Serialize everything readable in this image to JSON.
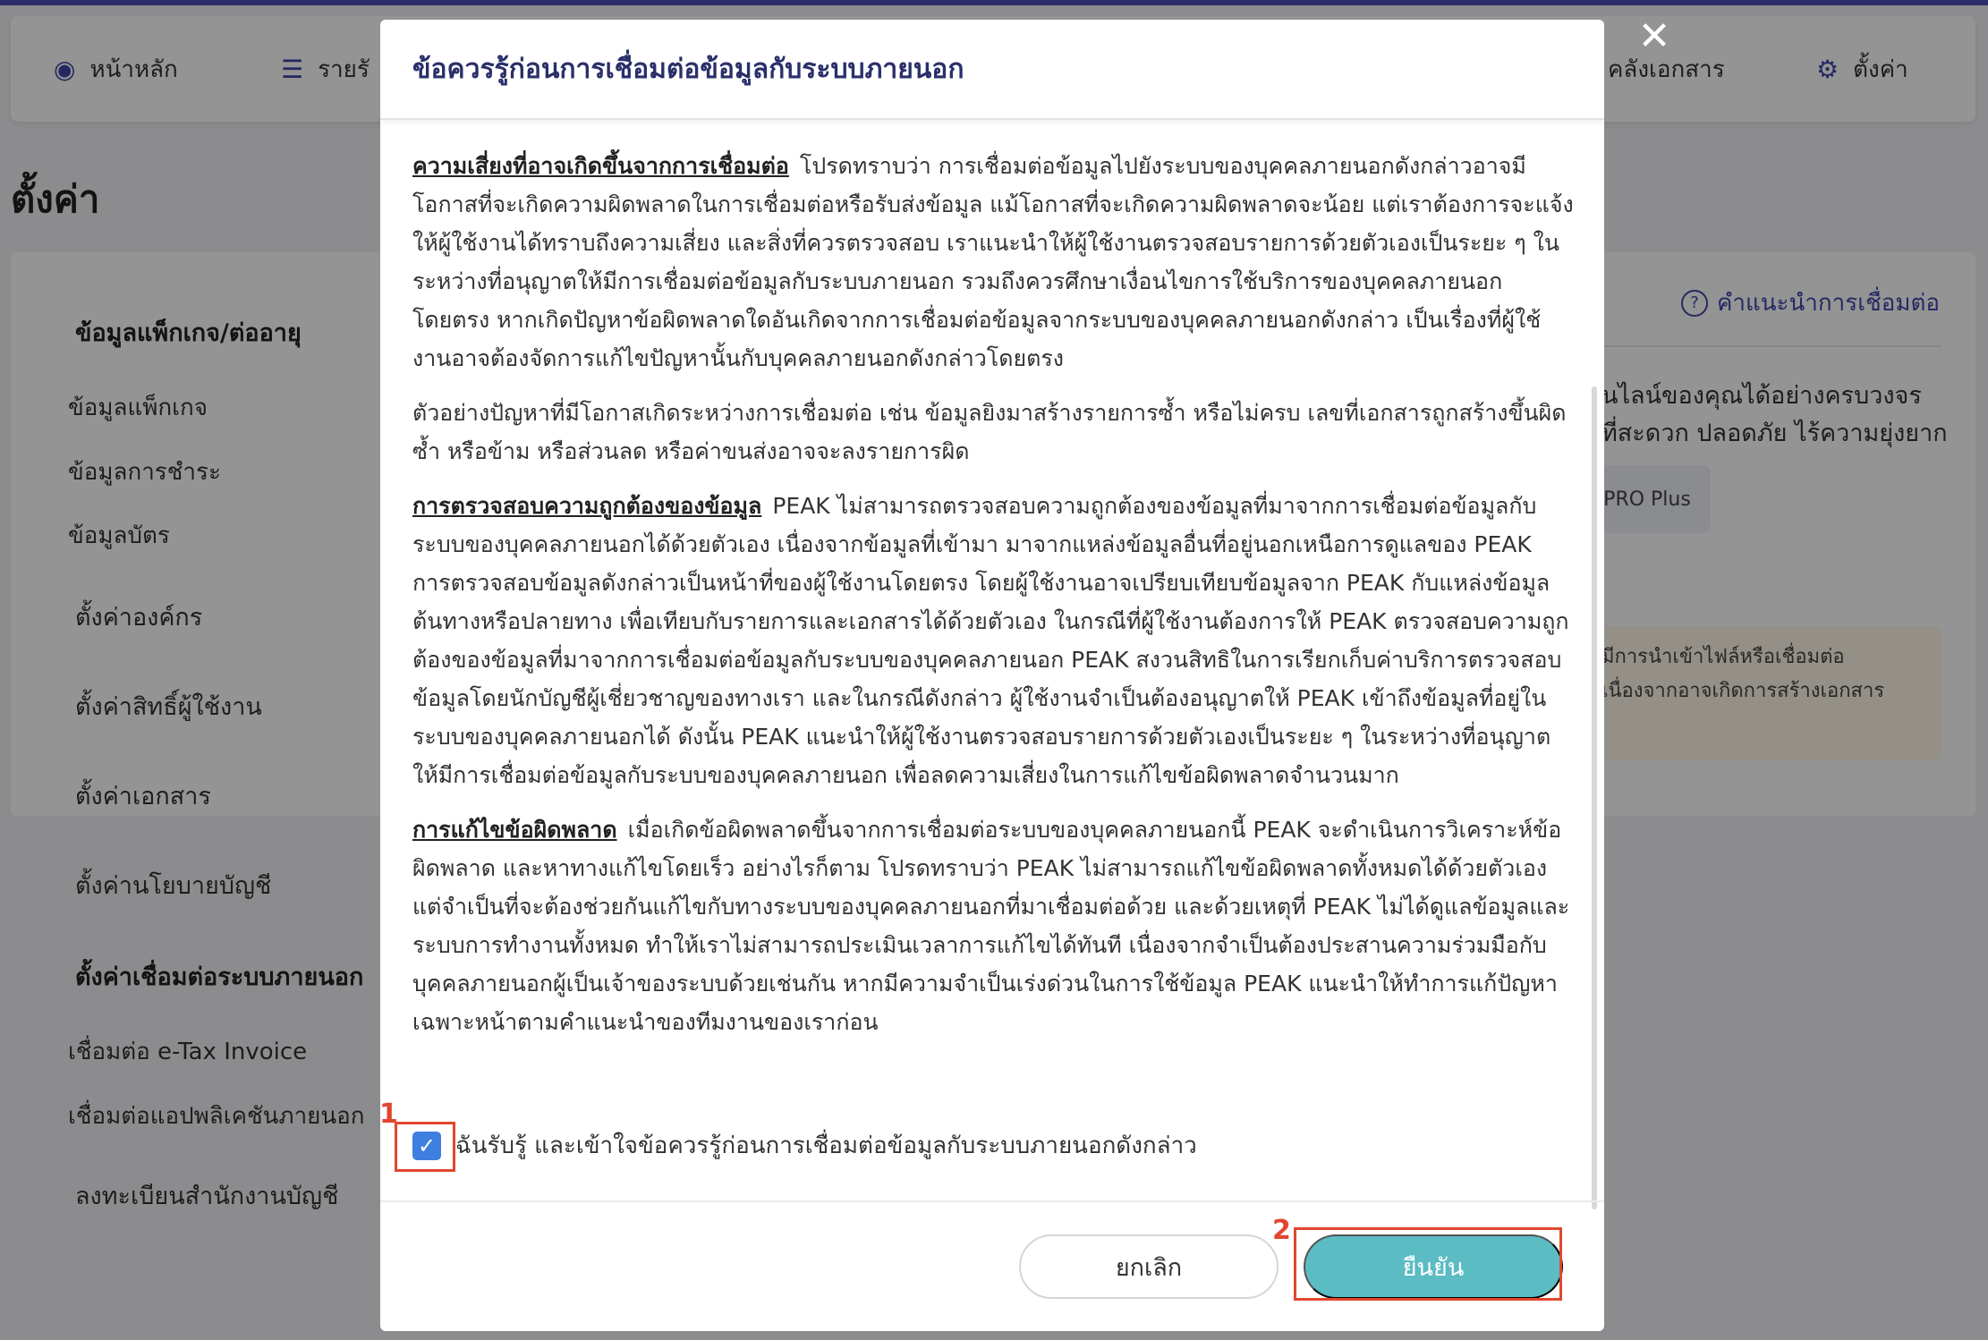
{
  "nav": {
    "home": "หน้าหลัก",
    "revenue": "รายรั",
    "documents": "คลังเอกสาร",
    "settings": "ตั้งค่า"
  },
  "page_title": "ตั้งค่า",
  "sidebar": {
    "package_head": "ข้อมูลแพ็กเกจ/ต่ออายุ",
    "package_items": [
      "ข้อมูลแพ็กเกจ",
      "ข้อมูลการชำระ",
      "ข้อมูลบัตร"
    ],
    "menus": [
      "ตั้งค่าองค์กร",
      "ตั้งค่าสิทธิ์ผู้ใช้งาน",
      "ตั้งค่าเอกสาร",
      "ตั้งค่านโยบายบัญชี"
    ],
    "integration_head": "ตั้งค่าเชื่อมต่อระบบภายนอก",
    "integration_items": [
      "เชื่อมต่อ e-Tax Invoice",
      "เชื่อมต่อแอปพลิเคชันภายนอก"
    ],
    "register": "ลงทะเบียนสำนักงานบัญชี"
  },
  "right_panel": {
    "help_link": "คำแนะนำการเชื่อมต่อ",
    "line1": "นไลน์ของคุณได้อย่างครบวงจร",
    "line2": "ที่สะดวก ปลอดภัย ไร้ความยุ่งยาก",
    "badge": "PRO Plus",
    "note1": "มีการนำเข้าไฟล์หรือเชื่อมต่อ",
    "note2": "เนื่องจากอาจเกิดการสร้างเอกสาร"
  },
  "modal": {
    "title": "ข้อควรรู้ก่อนการเชื่อมต่อข้อมูลกับระบบภายนอก",
    "p1_heading": "ความเสี่ยงที่อาจเกิดขึ้นจากการเชื่อมต่อ",
    "p1_text": "โปรดทราบว่า การเชื่อมต่อข้อมูลไปยังระบบของบุคคลภายนอกดังกล่าวอาจมีโอกาสที่จะเกิดความผิดพลาดในการเชื่อมต่อหรือรับส่งข้อมูล แม้โอกาสที่จะเกิดความผิดพลาดจะน้อย แต่เราต้องการจะแจ้งให้ผู้ใช้งานได้ทราบถึงความเสี่ยง และสิ่งที่ควรตรวจสอบ เราแนะนำให้ผู้ใช้งานตรวจสอบรายการด้วยตัวเองเป็นระยะ ๆ ในระหว่างที่อนุญาตให้มีการเชื่อมต่อข้อมูลกับระบบภายนอก รวมถึงควรศึกษาเงื่อนไขการใช้บริการของบุคคลภายนอกโดยตรง หากเกิดปัญหาข้อผิดพลาดใดอันเกิดจากการเชื่อมต่อข้อมูลจากระบบของบุคคลภายนอกดังกล่าว เป็นเรื่องที่ผู้ใช้งานอาจต้องจัดการแก้ไขปัญหานั้นกับบุคคลภายนอกดังกล่าวโดยตรง",
    "p2_text": "ตัวอย่างปัญหาที่มีโอกาสเกิดระหว่างการเชื่อมต่อ เช่น ข้อมูลยิงมาสร้างรายการซ้ำ หรือไม่ครบ เลขที่เอกสารถูกสร้างขึ้นผิด ซ้ำ หรือข้าม หรือส่วนลด หรือค่าขนส่งอาจจะลงรายการผิด",
    "p3_heading": "การตรวจสอบความถูกต้องของข้อมูล",
    "p3_text": "PEAK ไม่สามารถตรวจสอบความถูกต้องของข้อมูลที่มาจากการเชื่อมต่อข้อมูลกับระบบของบุคคลภายนอกได้ด้วยตัวเอง เนื่องจากข้อมูลที่เข้ามา มาจากแหล่งข้อมูลอื่นที่อยู่นอกเหนือการดูแลของ PEAK การตรวจสอบข้อมูลดังกล่าวเป็นหน้าที่ของผู้ใช้งานโดยตรง โดยผู้ใช้งานอาจเปรียบเทียบข้อมูลจาก PEAK กับแหล่งข้อมูลต้นทางหรือปลายทาง เพื่อเทียบกับรายการและเอกสารได้ด้วยตัวเอง ในกรณีที่ผู้ใช้งานต้องการให้ PEAK ตรวจสอบความถูกต้องของข้อมูลที่มาจากการเชื่อมต่อข้อมูลกับระบบของบุคคลภายนอก PEAK สงวนสิทธิในการเรียกเก็บค่าบริการตรวจสอบข้อมูลโดยนักบัญชีผู้เชี่ยวชาญของทางเรา และในกรณีดังกล่าว ผู้ใช้งานจำเป็นต้องอนุญาตให้ PEAK เข้าถึงข้อมูลที่อยู่ในระบบของบุคคลภายนอกได้ ดังนั้น PEAK แนะนำให้ผู้ใช้งานตรวจสอบรายการด้วยตัวเองเป็นระยะ ๆ ในระหว่างที่อนุญาตให้มีการเชื่อมต่อข้อมูลกับระบบของบุคคลภายนอก เพื่อลดความเสี่ยงในการแก้ไขข้อผิดพลาดจำนวนมาก",
    "p4_heading": "การแก้ไขข้อผิดพลาด",
    "p4_text": "เมื่อเกิดข้อผิดพลาดขึ้นจากการเชื่อมต่อระบบของบุคคลภายนอกนี้ PEAK จะดำเนินการวิเคราะห์ข้อผิดพลาด และหาทางแก้ไขโดยเร็ว อย่างไรก็ตาม โปรดทราบว่า PEAK ไม่สามารถแก้ไขข้อผิดพลาดทั้งหมดได้ด้วยตัวเอง แต่จำเป็นที่จะต้องช่วยกันแก้ไขกับทางระบบของบุคคลภายนอกที่มาเชื่อมต่อด้วย และด้วยเหตุที่ PEAK ไม่ได้ดูแลข้อมูลและระบบการทำงานทั้งหมด ทำให้เราไม่สามารถประเมินเวลาการแก้ไขได้ทันที เนื่องจากจำเป็นต้องประสานความร่วมมือกับบุคคลภายนอกผู้เป็นเจ้าของระบบด้วยเช่นกัน หากมีความจำเป็นเร่งด่วนในการใช้ข้อมูล PEAK แนะนำให้ทำการแก้ปัญหาเฉพาะหน้าตามคำแนะนำของทีมงานของเราก่อน",
    "ack_label": "ฉันรับรู้ และเข้าใจข้อควรรู้ก่อนการเชื่อมต่อข้อมูลกับระบบภายนอกดังกล่าว",
    "ack_checked": true,
    "cancel_label": "ยกเลิก",
    "confirm_label": "ยืนยัน"
  },
  "annotations": {
    "step1": "1",
    "step2": "2",
    "color": "#e2462e"
  },
  "colors": {
    "brand": "#3f47a8",
    "confirm": "#5bbcc4",
    "checkbox": "#3f7fe0"
  }
}
